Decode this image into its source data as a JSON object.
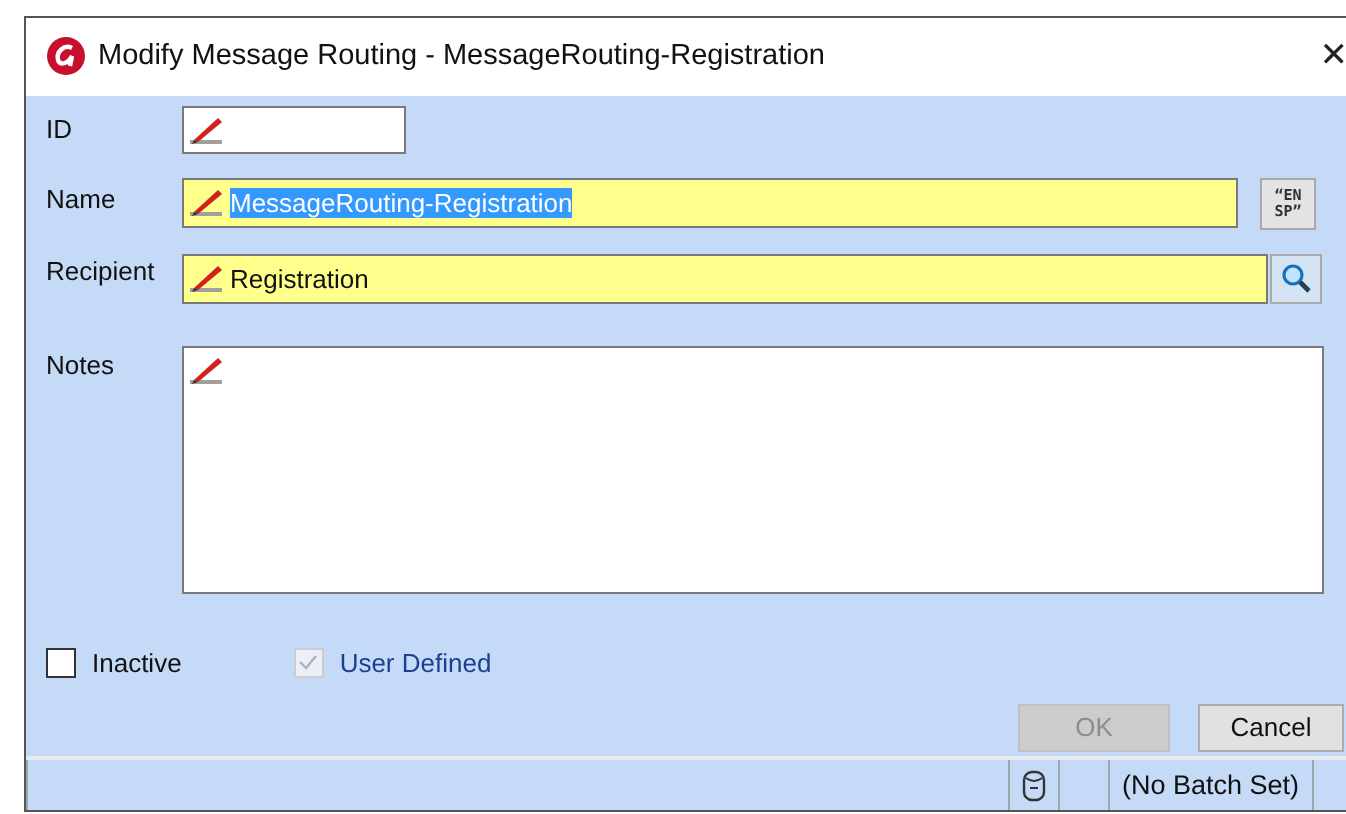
{
  "window": {
    "title": "Modify Message Routing - MessageRouting-Registration",
    "close": "✕"
  },
  "fields": {
    "id": {
      "label": "ID"
    },
    "name": {
      "label": "Name",
      "value": "MessageRouting-Registration",
      "selected": true,
      "spell_button": [
        "“EN",
        "SP”"
      ]
    },
    "recipient": {
      "label": "Recipient",
      "value": "Registration"
    },
    "notes": {
      "label": "Notes"
    }
  },
  "checkboxes": [
    {
      "label": "Inactive",
      "checked": false,
      "disabled": false
    },
    {
      "label": "User Defined",
      "checked": true,
      "disabled": true
    }
  ],
  "buttons": [
    {
      "label": "OK",
      "disabled": true
    },
    {
      "label": "Cancel",
      "disabled": false
    }
  ],
  "status_bar": {
    "batch": "(No Batch Set)"
  }
}
